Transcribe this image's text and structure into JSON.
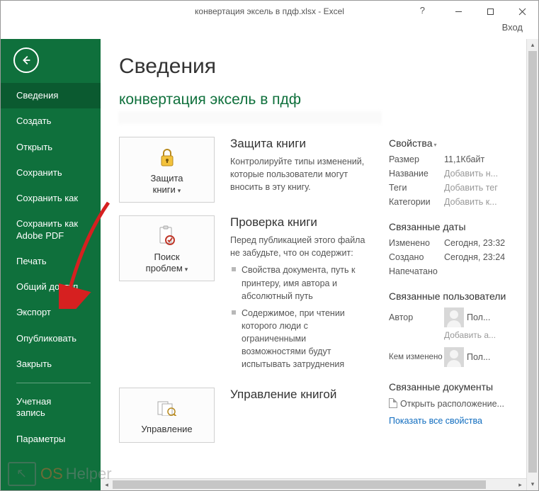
{
  "titlebar": {
    "title": "конвертация эксель в пдф.xlsx - Excel",
    "help": "?",
    "login": "Вход"
  },
  "sidebar": {
    "items": [
      {
        "label": "Сведения",
        "selected": true
      },
      {
        "label": "Создать"
      },
      {
        "label": "Открыть"
      },
      {
        "label": "Сохранить"
      },
      {
        "label": "Сохранить как"
      },
      {
        "label": "Сохранить как\nAdobe PDF"
      },
      {
        "label": "Печать"
      },
      {
        "label": "Общий доступ"
      },
      {
        "label": "Экспорт"
      },
      {
        "label": "Опубликовать"
      },
      {
        "label": "Закрыть"
      }
    ],
    "footer": [
      {
        "label": "Учетная\nзапись"
      },
      {
        "label": "Параметры"
      }
    ]
  },
  "main": {
    "page_title": "Сведения",
    "file_name": "конвертация эксель в пдф",
    "protect": {
      "btn": "Защита\nкниги",
      "hdr": "Защита книги",
      "body": "Контролируйте типы изменений, которые пользователи могут вносить в эту книгу."
    },
    "inspect": {
      "btn": "Поиск\nпроблем",
      "hdr": "Проверка книги",
      "body": "Перед публикацией этого файла не забудьте, что он содержит:",
      "items": [
        "Свойства документа, путь к принтеру, имя автора и абсолютный путь",
        "Содержимое, при чтении которого люди с ограниченными возможностями будут испытывать затруднения"
      ]
    },
    "manage": {
      "btn": "Управление",
      "hdr": "Управление книгой"
    }
  },
  "props": {
    "hdr": "Свойства",
    "size_k": "Размер",
    "size_v": "11,1Кбайт",
    "title_k": "Название",
    "title_v": "Добавить н...",
    "tags_k": "Теги",
    "tags_v": "Добавить тег",
    "cat_k": "Категории",
    "cat_v": "Добавить к...",
    "dates_hdr": "Связанные даты",
    "mod_k": "Изменено",
    "mod_v": "Сегодня, 23:32",
    "cre_k": "Создано",
    "cre_v": "Сегодня, 23:24",
    "prn_k": "Напечатано",
    "users_hdr": "Связанные пользователи",
    "auth_k": "Автор",
    "auth_v": "Пол...",
    "add_auth": "Добавить а...",
    "chg_k": "Кем изменено",
    "chg_v": "Пол...",
    "docs_hdr": "Связанные документы",
    "open_loc": "Открыть расположение...",
    "show_all": "Показать все свойства"
  },
  "watermark": {
    "t1": "OS",
    "t2": "Helper"
  }
}
